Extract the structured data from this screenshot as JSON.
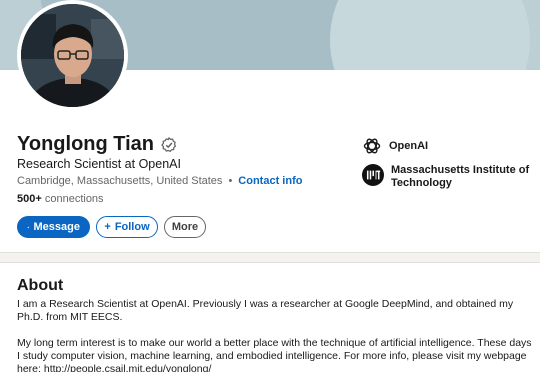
{
  "profile": {
    "name": "Yonglong Tian",
    "headline": "Research Scientist at OpenAI",
    "location": "Cambridge, Massachusetts, United States",
    "location_separator": "•",
    "contact_label": "Contact info",
    "connections_count": "500+",
    "connections_label": "connections"
  },
  "actions": {
    "message": "Message",
    "follow": "Follow",
    "more": "More"
  },
  "companies": [
    {
      "name": "OpenAI",
      "icon": "openai-logo-icon"
    },
    {
      "name": "Massachusetts Institute of Technology",
      "icon": "mit-logo-icon"
    }
  ],
  "about": {
    "title": "About",
    "paragraph1": "I am a Research Scientist at OpenAI. Previously I was a researcher at Google DeepMind, and obtained my Ph.D. from MIT EECS.",
    "paragraph2": "My long term interest is to make our world a better place with the technique of artificial intelligence. These days I study computer vision, machine learning, and embodied intelligence. For more info, please visit my webpage here:  http://people.csail.mit.edu/yonglong/"
  },
  "colors": {
    "accent": "#0a66c2",
    "banner": "#bccfd5",
    "page_bg": "#f4f2ee"
  }
}
